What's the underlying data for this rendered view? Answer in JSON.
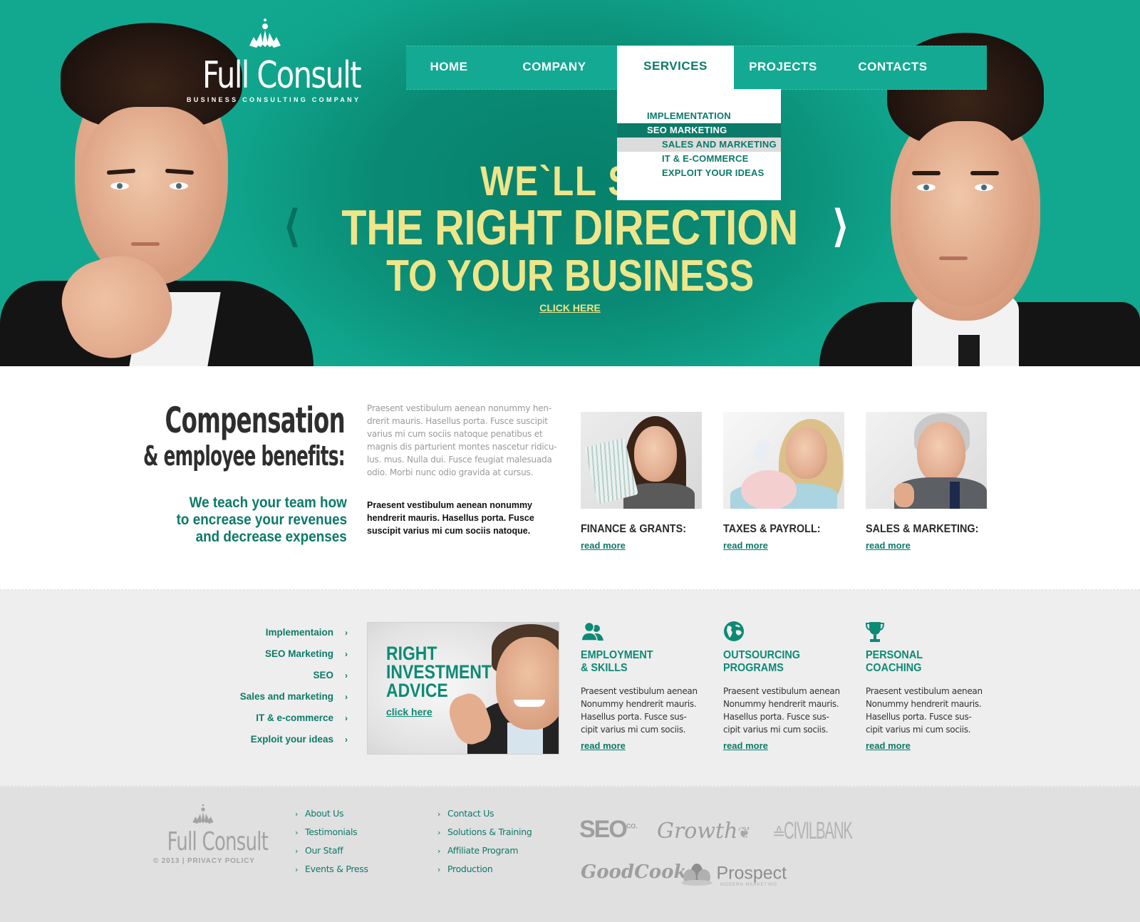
{
  "brand": {
    "name": "Full Consult",
    "tagline": "BUSINESS CONSULTING COMPANY",
    "logo_icon": "lotus-icon"
  },
  "colors": {
    "primary": "#0d8a74",
    "hero_bg": "#0a8a74",
    "slogan": "#efe58a",
    "text_dark": "#2e2e2e",
    "footer_bg": "#e0e0e0"
  },
  "nav": {
    "items": [
      {
        "label": "HOME"
      },
      {
        "label": "COMPANY"
      },
      {
        "label": "SERVICES",
        "active": true
      },
      {
        "label": "PROJECTS"
      },
      {
        "label": "CONTACTS"
      }
    ],
    "dropdown": [
      {
        "label": "IMPLEMENTATION",
        "level": 1
      },
      {
        "label": "SEO MARKETING",
        "level": 1,
        "state": "active"
      },
      {
        "label": "SALES AND MARKETING",
        "level": 2,
        "state": "hover"
      },
      {
        "label": "IT & E-COMMERCE",
        "level": 2
      },
      {
        "label": "EXPLOIT YOUR IDEAS",
        "level": 2
      }
    ]
  },
  "hero": {
    "line1": "WE`LL SHOW YOU",
    "line1_visible": "WE`LL SH",
    "line2": "THE RIGHT DIRECTION",
    "line3": "TO YOUR BUSINESS",
    "cta": "CLICK HERE",
    "prev_icon": "chevron-left-icon",
    "next_icon": "chevron-right-icon"
  },
  "intro": {
    "title_line1": "Compensation",
    "title_line2": "& employee benefits:",
    "teach_lines": [
      "We teach your team how",
      "to encrease your revenues",
      "and decrease expenses"
    ],
    "paragraph_gray": "Praesent vestibulum aenean nonummy hen-drerit mauris. Hasellus porta. Fusce suscipit varius mi cum sociis natoque penatibus et magnis dis parturient montes nascetur ridicu-lus. mus. Nulla dui. Fusce feugiat malesuada odio. Morbi nunc odio gravida at cursus.",
    "paragraph_dark": "Praesent vestibulum aenean nonummy hendrerit mauris. Hasellus porta. Fusce suscipit varius mi cum sociis natoque."
  },
  "features": [
    {
      "title": "FINANCE & GRANTS:",
      "link": "read more",
      "image": "woman-with-cash-photo"
    },
    {
      "title": "TAXES & PAYROLL:",
      "link": "read more",
      "image": "woman-with-piggy-bank-photo"
    },
    {
      "title": "SALES & MARKETING:",
      "link": "read more",
      "image": "man-thumbs-up-photo"
    }
  ],
  "sidebar_links": [
    {
      "label": "Implementaion"
    },
    {
      "label": "SEO Marketing"
    },
    {
      "label": "SEO"
    },
    {
      "label": "Sales and marketing"
    },
    {
      "label": "IT & e-commerce"
    },
    {
      "label": "Exploit your ideas"
    }
  ],
  "banner": {
    "title_lines": [
      "RIGHT",
      "INVESTMENT",
      "ADVICE"
    ],
    "link": "click here"
  },
  "services": [
    {
      "icon": "users-icon",
      "title_lines": [
        "EMPLOYMENT",
        "& SKILLS"
      ],
      "text": "Praesent vestibulum aenean Nonummy hendrerit mauris. Hasellus porta. Fusce sus-cipit varius mi cum sociis.",
      "link": "read more"
    },
    {
      "icon": "globe-icon",
      "title_lines": [
        "OUTSOURCING",
        "PROGRAMS"
      ],
      "text": "Praesent vestibulum aenean Nonummy hendrerit mauris. Hasellus porta. Fusce sus-cipit varius mi cum sociis.",
      "link": "read more"
    },
    {
      "icon": "trophy-icon",
      "title_lines": [
        "PERSONAL",
        "COACHING"
      ],
      "text": "Praesent vestibulum aenean Nonummy hendrerit mauris. Hasellus porta. Fusce sus-cipit varius mi cum sociis.",
      "link": "read more"
    }
  ],
  "footer": {
    "brand": "Full Consult",
    "copyright": "© 2013",
    "separator": "|",
    "privacy": "PRIVACY POLICY",
    "col1": [
      "About Us",
      "Testimonials",
      "Our Staff",
      "Events & Press"
    ],
    "col2": [
      "Contact Us",
      "Solutions & Training",
      "Affiliate Program",
      "Production"
    ],
    "partners": [
      {
        "name": "SEO",
        "suffix": "CO."
      },
      {
        "name": "Growth"
      },
      {
        "name": "CIVILBANK"
      },
      {
        "name": "GoodCook"
      },
      {
        "name": "Prospect",
        "sub": "MODERN MARKETING"
      }
    ]
  }
}
